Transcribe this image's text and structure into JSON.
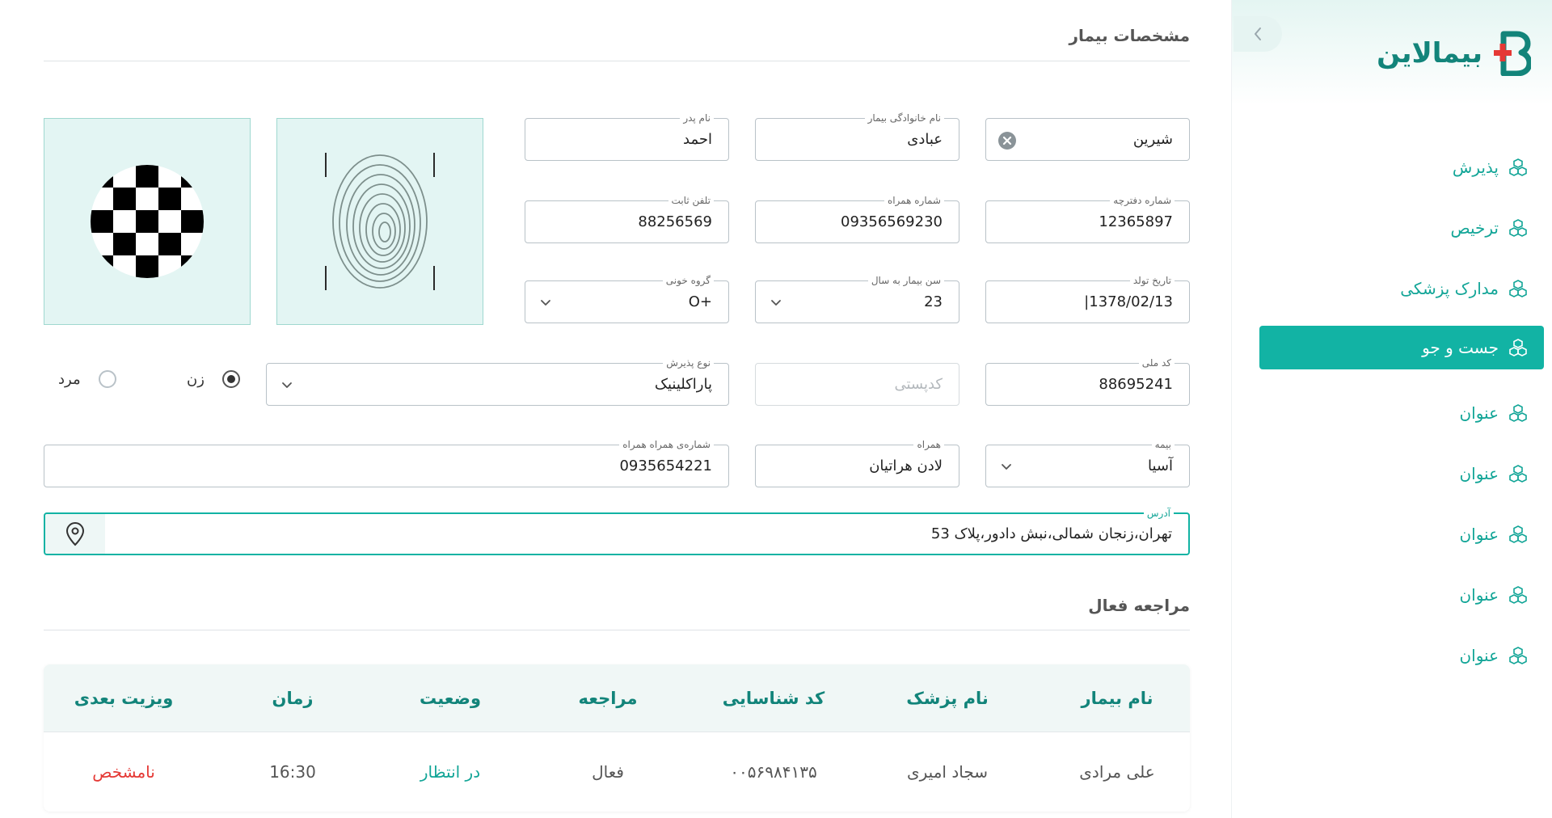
{
  "brand": {
    "name": "بیمالاین",
    "accent": "#12b3a4",
    "primary_dark": "#12847a"
  },
  "sidebar": {
    "items": [
      {
        "label": "پذیرش",
        "icon": "cubes-icon",
        "active": false
      },
      {
        "label": "ترخیص",
        "icon": "cubes-icon",
        "active": false
      },
      {
        "label": "مدارک پزشکی",
        "icon": "cubes-icon",
        "active": false
      },
      {
        "label": "جست و جو",
        "icon": "cubes-icon",
        "active": true
      },
      {
        "label": "عنوان",
        "icon": "cubes-icon",
        "active": false
      },
      {
        "label": "عنوان",
        "icon": "cubes-icon",
        "active": false
      },
      {
        "label": "عنوان",
        "icon": "cubes-icon",
        "active": false
      },
      {
        "label": "عنوان",
        "icon": "cubes-icon",
        "active": false
      },
      {
        "label": "عنوان",
        "icon": "cubes-icon",
        "active": false
      }
    ]
  },
  "patient_section": {
    "title": "مشخصات بیمار"
  },
  "form": {
    "first_name": {
      "label": "",
      "value": "شیرین"
    },
    "last_name": {
      "label": "نام خانوادگی بیمار",
      "value": "عبادی"
    },
    "father_name": {
      "label": "نام پدر",
      "value": "احمد"
    },
    "file_number": {
      "label": "شماره دفترچه",
      "value": "12365897"
    },
    "mobile": {
      "label": "شماره همراه",
      "value": "09356569230"
    },
    "landline": {
      "label": "تلفن ثابت",
      "value": "88256569"
    },
    "birth_date": {
      "label": "تاریخ تولد",
      "value": "1378/02/13|"
    },
    "age": {
      "label": "سن بیمار به سال",
      "value": "23"
    },
    "blood_group": {
      "label": "گروه خونی",
      "value": "O+"
    },
    "national_id": {
      "label": "کد ملی",
      "value": "88695241"
    },
    "postal_code": {
      "placeholder": "کدپستی"
    },
    "admission_type": {
      "label": "نوع پذیرش",
      "value": "پاراکلینیک"
    },
    "gender": {
      "female_label": "زن",
      "male_label": "مرد",
      "selected": "female"
    },
    "insurance": {
      "label": "بیمه",
      "value": "آسیا"
    },
    "companion": {
      "label": "همراه",
      "value": "لادن هراتیان"
    },
    "companion_mobile": {
      "label": "شماره‌ی همراه همراه",
      "value": "0935654221"
    },
    "address": {
      "label": "آدرس",
      "value": "تهران،زنجان شمالی،نبش دادور،پلاک 53"
    }
  },
  "active_section": {
    "title": "مراجعه فعال"
  },
  "table": {
    "headers": [
      "نام بیمار",
      "نام پزشک",
      "کد شناسایی",
      "مراجعه",
      "وضعیت",
      "زمان",
      "ویزیت بعدی"
    ],
    "rows": [
      [
        "علی مرادی",
        "سجاد امیری",
        "۰۰۵۶۹۸۴۱۳۵",
        "فعال",
        "در انتظار",
        "16:30",
        "نامشخص"
      ]
    ],
    "status_color": "#12a597",
    "next_visit_color": "#e53935"
  }
}
